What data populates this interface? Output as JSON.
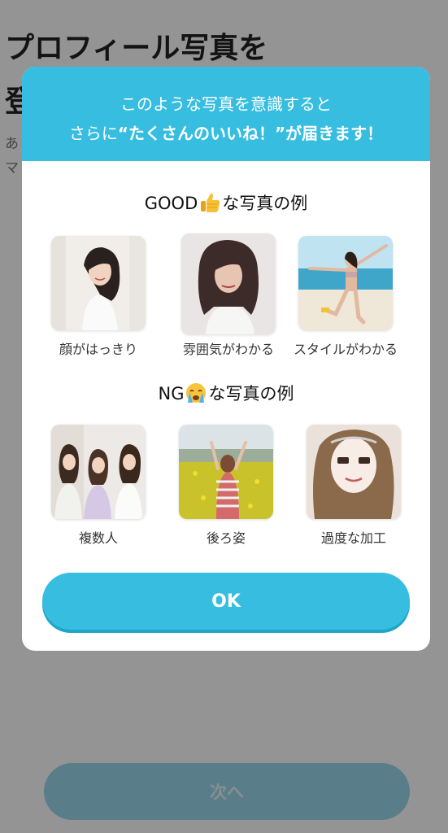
{
  "background": {
    "title_line1": "プロフィール写真を",
    "title_line2": "登",
    "subtitle_line1": "あ",
    "subtitle_line2": "マ",
    "next_button": "次へ"
  },
  "modal": {
    "header_line1": "このような写真を意識すると",
    "header_line2_prefix": "さらに",
    "header_line2_bold": "“たくさんのいいね！”が届きます！",
    "good_section": {
      "prefix": "GOOD",
      "emoji": "thumbs-up",
      "suffix": "な写真の例"
    },
    "good_examples": [
      "顔がはっきり",
      "雰囲気がわかる",
      "スタイルがわかる"
    ],
    "ng_section": {
      "prefix": "NG",
      "emoji": "crying-face",
      "suffix": "な写真の例"
    },
    "ng_examples": [
      "複数人",
      "後ろ姿",
      "過度な加工"
    ],
    "ok_button": "OK"
  },
  "colors": {
    "accent": "#36bddf",
    "accent_shadow": "#1ea6c8"
  }
}
